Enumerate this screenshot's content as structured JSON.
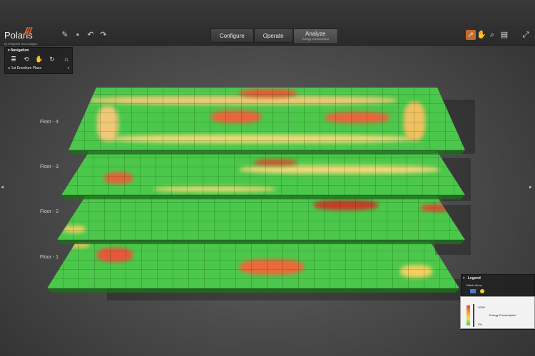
{
  "app": {
    "name": "Polaris",
    "byline": "by Enlighted Technologies"
  },
  "modes": [
    {
      "label": "Configure"
    },
    {
      "label": "Operate"
    },
    {
      "label": "Analyze",
      "sub": "Energy Consumption",
      "active": true
    }
  ],
  "navigation": {
    "title": "Navigation",
    "location": "1st Encelium Place"
  },
  "floors": [
    "Floor - 4",
    "Floor - 3",
    "Floor - 2",
    "Floor - 1"
  ],
  "legend": {
    "title": "Legend",
    "visible_items": "Visible Items",
    "max": "100%",
    "min": "0%",
    "metric": "Energy Consumption",
    "colors": {
      "high": "#e8442a",
      "mid": "#f0a030",
      "low": "#4bc84b"
    }
  },
  "icons": {
    "left_tools": [
      "pencil-icon",
      "save-icon",
      "undo-icon",
      "redo-icon"
    ],
    "right_tools": [
      "select-pointer-icon",
      "pan-hand-icon",
      "zoom-icon",
      "properties-icon"
    ],
    "nav": [
      "floors-icon",
      "rotate-icon",
      "pan-icon",
      "orbit-icon",
      "home-icon"
    ]
  }
}
